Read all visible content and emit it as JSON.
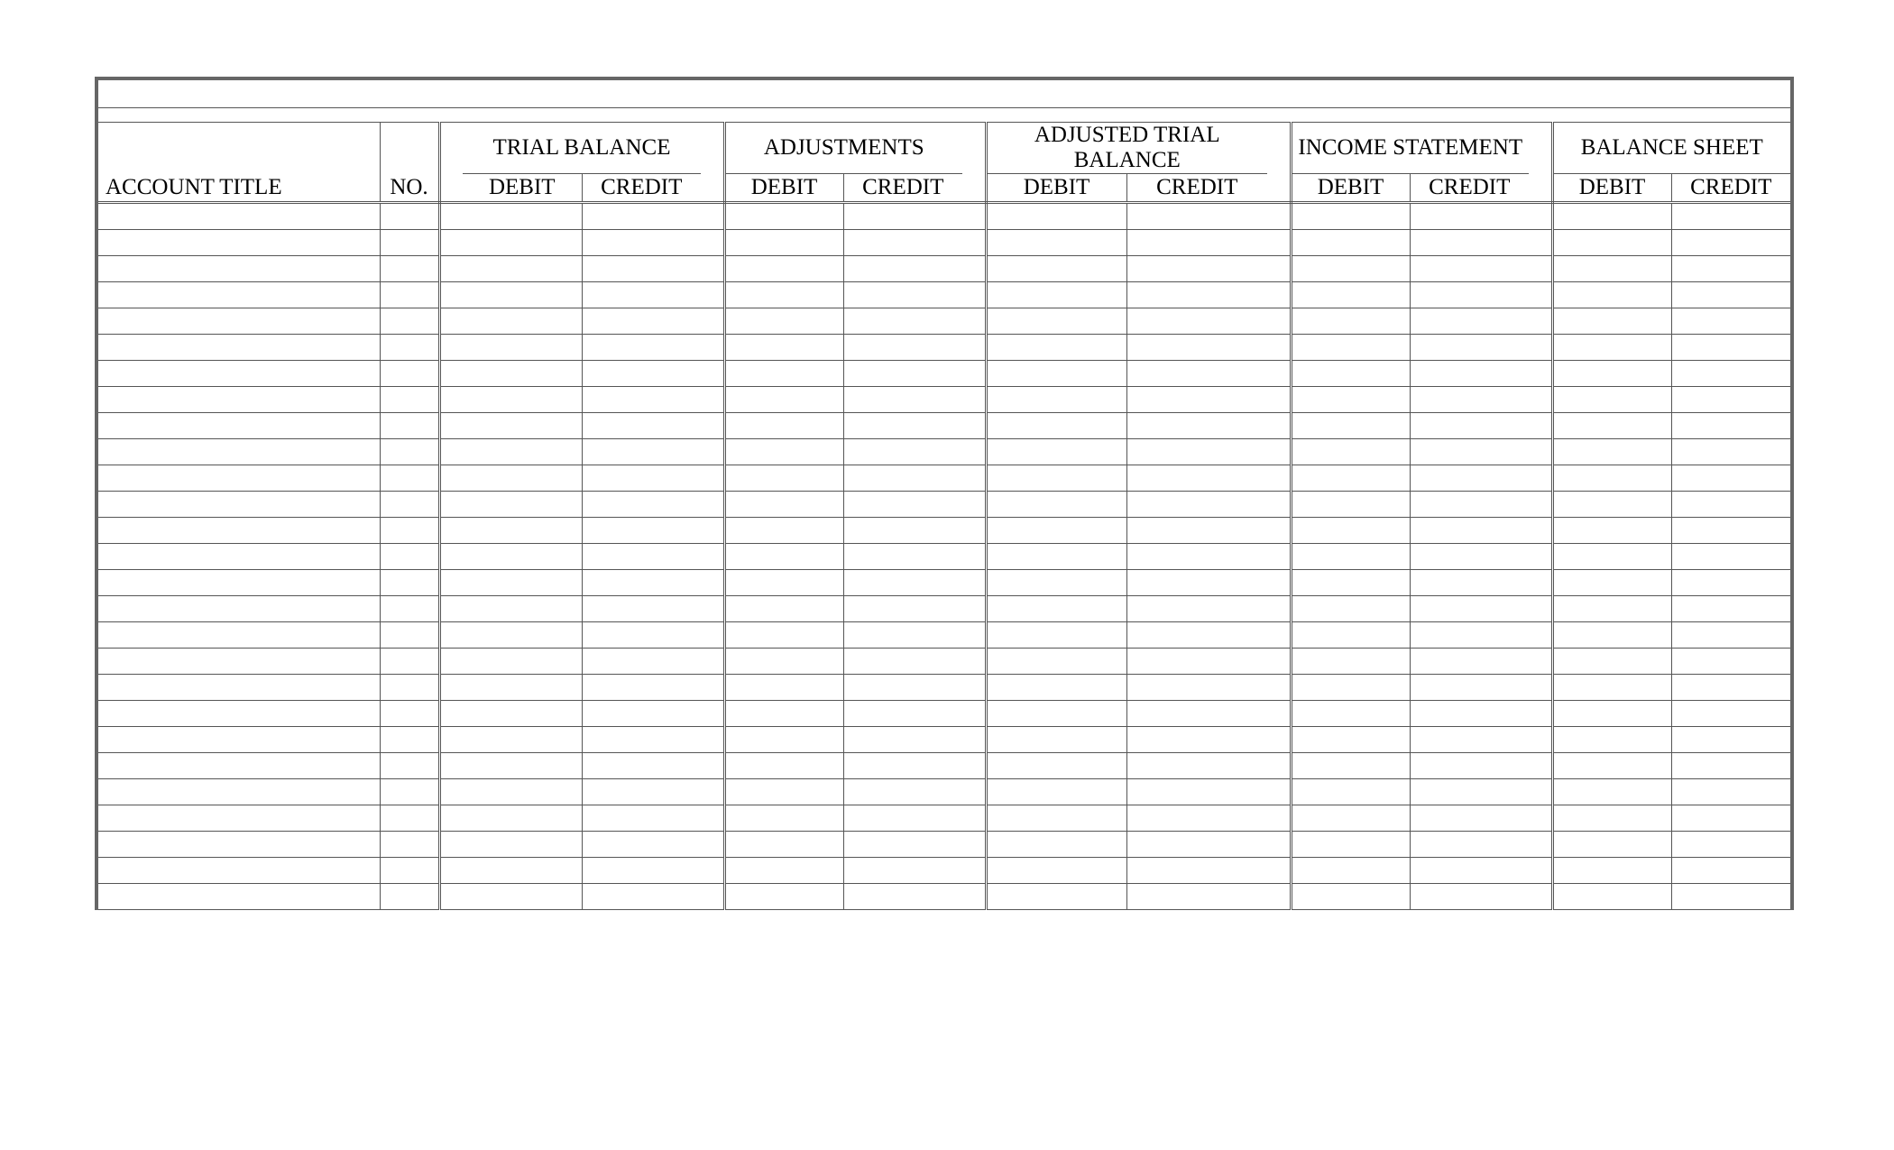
{
  "worksheet": {
    "headers": {
      "account_title": "ACCOUNT TITLE",
      "no": "NO.",
      "debit": "DEBIT",
      "credit": "CREDIT"
    },
    "sections": {
      "trial_balance": "TRIAL BALANCE",
      "adjustments": "ADJUSTMENTS",
      "adjusted_trial_balance": "ADJUSTED TRIAL BALANCE",
      "income_statement": "INCOME STATEMENT",
      "balance_sheet": "BALANCE SHEET"
    },
    "row_count": 27
  }
}
